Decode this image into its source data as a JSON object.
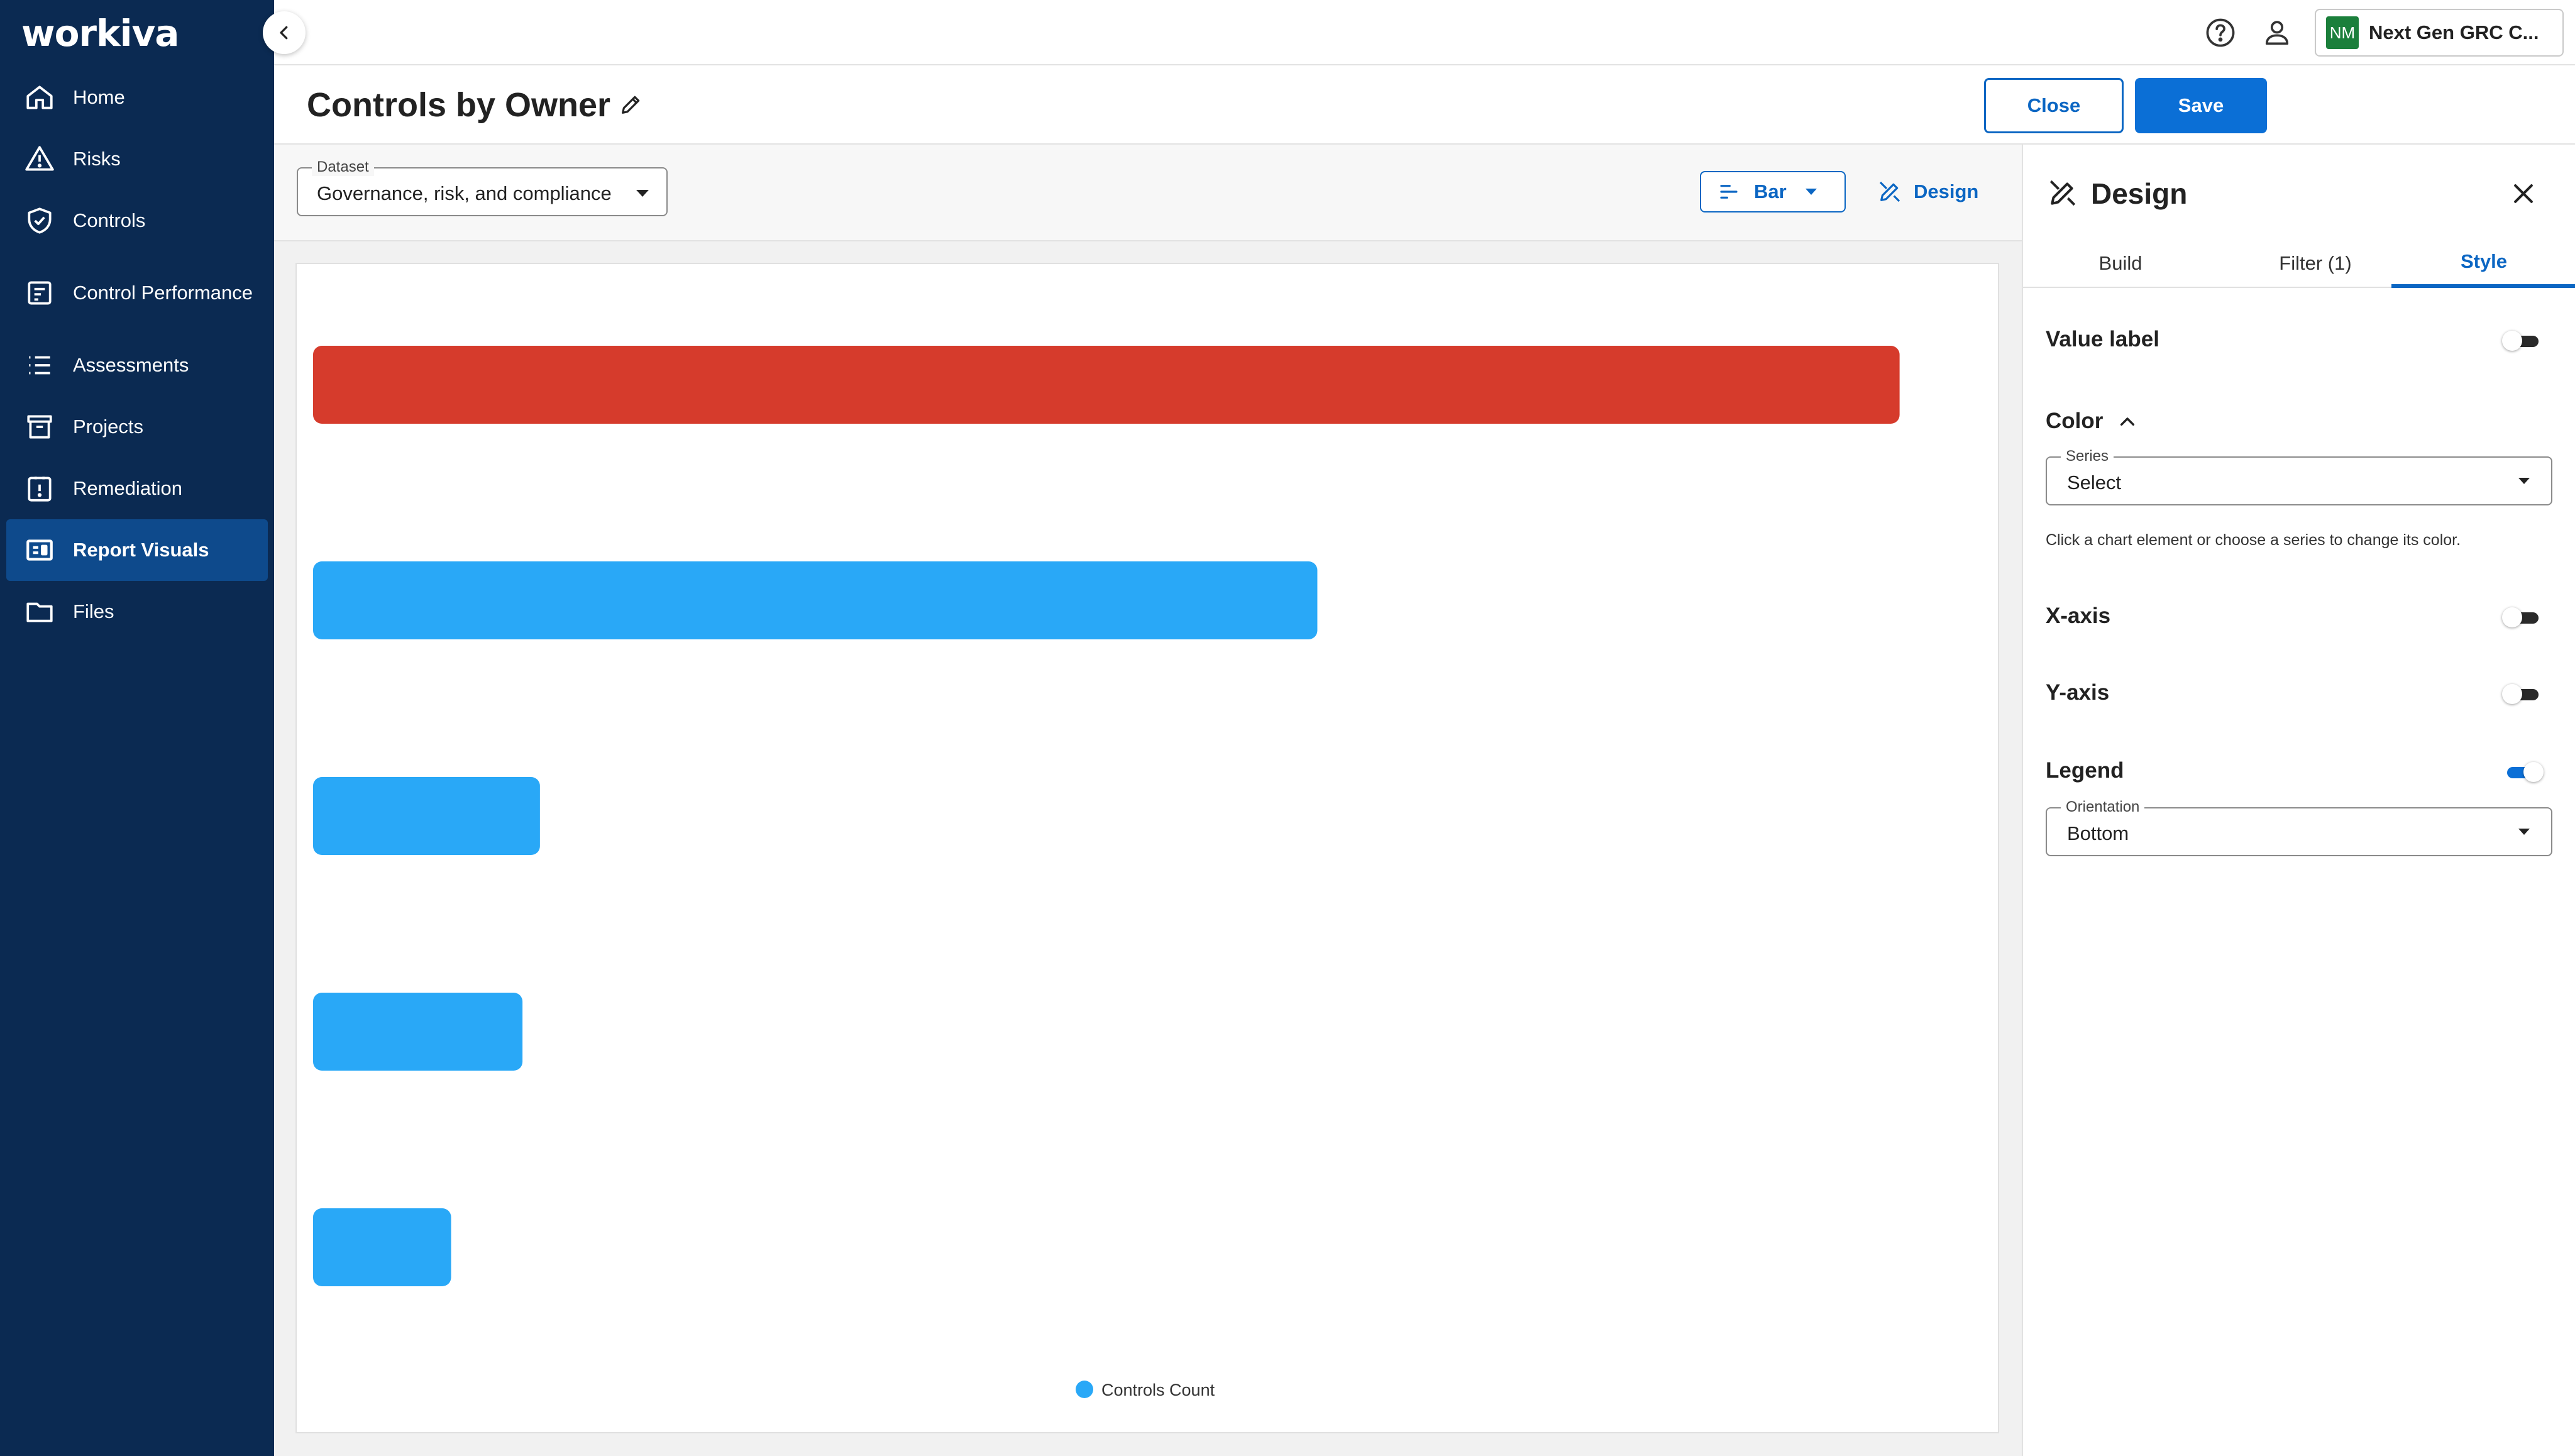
{
  "app": {
    "logo_text": "workiva",
    "org_badge": "NM",
    "org_name": "Next Gen GRC C..."
  },
  "sidebar": {
    "items": [
      {
        "label": "Home",
        "icon": "home-icon"
      },
      {
        "label": "Risks",
        "icon": "warning-icon"
      },
      {
        "label": "Controls",
        "icon": "shield-icon"
      },
      {
        "label": "Control Performance",
        "icon": "performance-icon"
      },
      {
        "label": "Assessments",
        "icon": "list-icon"
      },
      {
        "label": "Projects",
        "icon": "archive-icon"
      },
      {
        "label": "Remediation",
        "icon": "alert-square-icon"
      },
      {
        "label": "Report Visuals",
        "icon": "report-visuals-icon",
        "active": true
      },
      {
        "label": "Files",
        "icon": "folder-icon"
      }
    ]
  },
  "header": {
    "title": "Controls by Owner",
    "close_label": "Close",
    "save_label": "Save"
  },
  "toolbar": {
    "dataset_label": "Dataset",
    "dataset_value": "Governance, risk, and compliance",
    "chart_type_label": "Bar",
    "design_label": "Design"
  },
  "chart_data": {
    "type": "bar",
    "orientation": "horizontal",
    "categories": [
      "",
      "",
      "",
      "",
      ""
    ],
    "series": [
      {
        "name": "Controls Count",
        "values": [
          100,
          63.3,
          14.3,
          13.2,
          8.7
        ],
        "color": "#29a8f7"
      }
    ],
    "highlight_index": 0,
    "highlight_color": "#d63b2c",
    "xlim": [
      0,
      110
    ],
    "legend_position": "bottom",
    "value_labels": false,
    "x_axis": false,
    "y_axis": false,
    "grid": false
  },
  "panel": {
    "title": "Design",
    "tabs": [
      {
        "label": "Build"
      },
      {
        "label": "Filter (1)"
      },
      {
        "label": "Style",
        "active": true
      }
    ],
    "value_label": "Value label",
    "value_label_on": false,
    "color_label": "Color",
    "series_field_label": "Series",
    "series_field_value": "Select",
    "color_helper": "Click a chart element or choose a series to change its color.",
    "x_axis_label": "X-axis",
    "x_axis_on": false,
    "y_axis_label": "Y-axis",
    "y_axis_on": false,
    "legend_label": "Legend",
    "legend_on": true,
    "orientation_field_label": "Orientation",
    "orientation_field_value": "Bottom"
  },
  "colors": {
    "sidebar_bg": "#0b2a52",
    "sidebar_active": "#0e4a8c",
    "accent": "#0b66c3",
    "bar": "#29a8f7",
    "bar_highlight": "#d63b2c"
  }
}
